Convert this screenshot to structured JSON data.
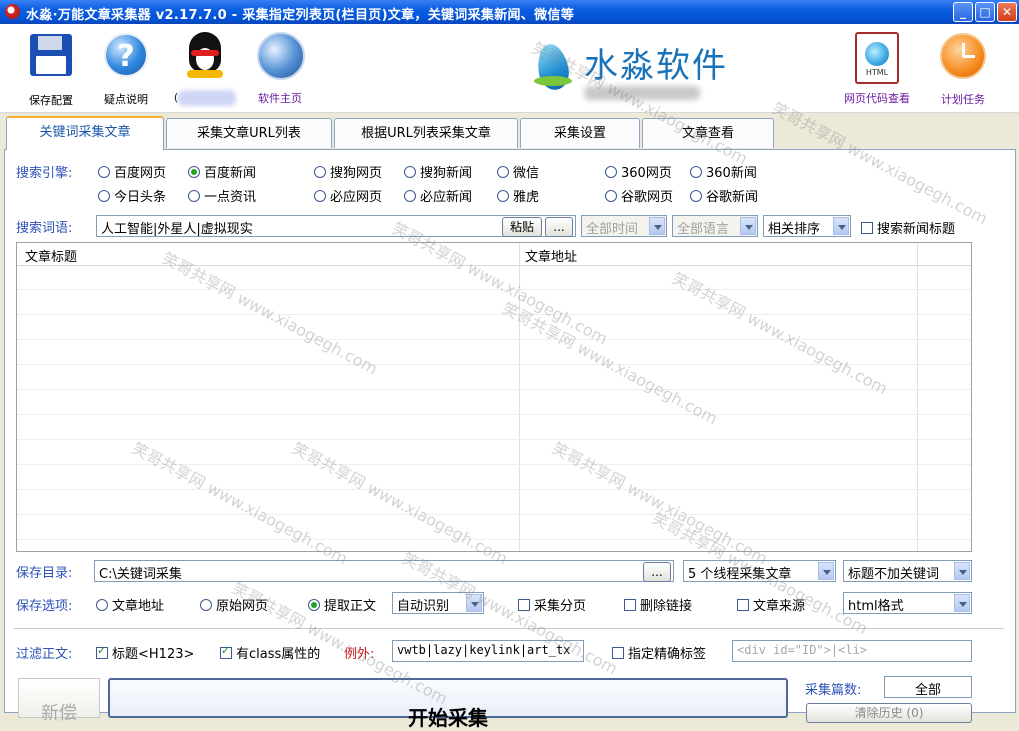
{
  "window": {
    "title": "水淼·万能文章采集器 v2.17.7.0 - 采集指定列表页(栏目页)文章，关键词采集新闻、微信等"
  },
  "toolbar": {
    "save_config": "保存配置",
    "faq": "疑点说明",
    "qq_prefix": "(",
    "homepage": "软件主页",
    "logo_text": "水淼软件",
    "page_code": "网页代码查看",
    "schedule": "计划任务",
    "html_icon_text": "HTML"
  },
  "tabs": [
    "关键词采集文章",
    "采集文章URL列表",
    "根据URL列表采集文章",
    "采集设置",
    "文章查看"
  ],
  "engine": {
    "label": "搜索引擎:",
    "row1": [
      "百度网页",
      "百度新闻",
      "搜狗网页",
      "搜狗新闻",
      "微信",
      "360网页",
      "360新闻"
    ],
    "row2": [
      "今日头条",
      "一点资讯",
      "必应网页",
      "必应新闻",
      "雅虎",
      "谷歌网页",
      "谷歌新闻"
    ],
    "selected": "百度新闻"
  },
  "search": {
    "label": "搜索词语:",
    "value": "人工智能|外星人|虚拟现实",
    "paste": "粘贴",
    "more": "...",
    "time": "全部时间",
    "lang": "全部语言",
    "sort": "相关排序",
    "news_title_check": "搜索新闻标题"
  },
  "table": {
    "columns": [
      "文章标题",
      "文章地址"
    ],
    "rows": []
  },
  "save_dir": {
    "label": "保存目录:",
    "value": "C:\\关键词采集",
    "more": "...",
    "threads": "5 个线程采集文章",
    "title_mode": "标题不加关键词"
  },
  "save_options": {
    "label": "保存选项:",
    "radios": [
      "文章地址",
      "原始网页",
      "提取正文"
    ],
    "selected": "提取正文",
    "detect": "自动识别",
    "checks": [
      "采集分页",
      "删除链接",
      "文章来源"
    ],
    "format": "html格式"
  },
  "filter": {
    "label": "过滤正文:",
    "title_tag": "标题<H123>",
    "class_attr": "有class属性的",
    "except_label": "例外:",
    "except_value": "vwtb|lazy|keylink|art_tx",
    "exact_tag": "指定精确标签",
    "exact_placeholder": "<div id=\"ID\">|<li>"
  },
  "bottom": {
    "new_btn": "新偿",
    "start_btn": "开始采集",
    "count_label": "采集篇数:",
    "count_value": "全部",
    "clear_history": "清除历史 (0)"
  },
  "watermark": {
    "cn": "笑哥共享网",
    "url": "www.xiaogegh.com"
  },
  "colors": {
    "title_bar": "#0a5ee0",
    "label_blue": "#2d53b8",
    "tab_accent": "#f2b231",
    "except_red": "#d21818"
  }
}
